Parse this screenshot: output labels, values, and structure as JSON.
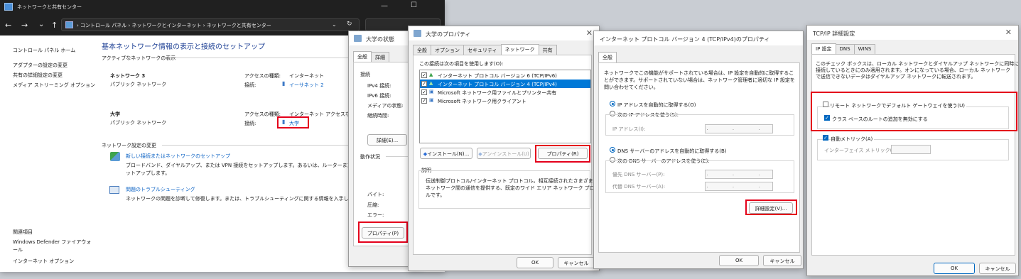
{
  "network_center": {
    "title": "ネットワークと共有センター",
    "breadcrumb": [
      "コントロール パネル",
      "ネットワークとインターネット",
      "ネットワークと共有センター"
    ],
    "sidebar_links": [
      "コントロール パネル ホーム",
      "アダプターの設定の変更",
      "共有の詳細設定の変更",
      "メディア ストリーミング オプション"
    ],
    "related_title": "関連項目",
    "related_links": [
      "Windows Defender ファイアウォール",
      "インターネット オプション"
    ],
    "heading": "基本ネットワーク情報の表示と接続のセットアップ",
    "active_networks_label": "アクティブなネットワークの表示",
    "access_type_label": "アクセスの種類:",
    "connection_label": "接続:",
    "networks": [
      {
        "name": "ネットワーク 3",
        "type": "パブリック ネットワーク",
        "access": "インターネット",
        "connection": "イーサネット 2"
      },
      {
        "name": "大学",
        "type": "パブリック ネットワーク",
        "access": "インターネット アクセスなし",
        "connection": "大学"
      }
    ],
    "change_settings_label": "ネットワーク設定の変更",
    "tasks": [
      {
        "title": "新しい接続またはネットワークのセットアップ",
        "desc1": "ブロードバンド、ダイヤルアップ、または VPN 接続をセットアップします。あるいは、ルーターまたはアクセス ポイ",
        "desc2": "ットアップします。"
      },
      {
        "title": "問題のトラブルシューティング",
        "desc1": "ネットワークの問題を診断して修復します。または、トラブルシューティングに関する情報を入手します。",
        "desc2": ""
      }
    ]
  },
  "status_dialog": {
    "title": "大学の状態",
    "tabs": [
      "全般",
      "詳細"
    ],
    "connection_label": "接続",
    "fields": [
      "IPv4 接続:",
      "IPv6 接続:",
      "メディアの状態:",
      "継続時間:"
    ],
    "details_button": "詳細(E)...",
    "activity_label": "動作状況",
    "stats": [
      "バイト:",
      "圧縮:",
      "エラー:"
    ],
    "properties_button": "プロパティ(P)"
  },
  "properties_dialog": {
    "title": "大学のプロパティ",
    "tabs": [
      "全般",
      "オプション",
      "セキュリティ",
      "ネットワーク",
      "共有"
    ],
    "items_label": "この接続は次の項目を使用します(O):",
    "items": [
      {
        "label": "インターネット プロトコル バージョン 6 (TCP/IPv6)",
        "checked": true,
        "selected": false
      },
      {
        "label": "インターネット プロトコル バージョン 4 (TCP/IPv4)",
        "checked": true,
        "selected": true
      },
      {
        "label": "Microsoft ネットワーク用ファイルとプリンター共有",
        "checked": true,
        "selected": false
      },
      {
        "label": "Microsoft ネットワーク用クライアント",
        "checked": true,
        "selected": false
      }
    ],
    "install_button": "インストール(N)...",
    "uninstall_button": "アンインストール(U)",
    "properties_button": "プロパティ(R)",
    "description_label": "説明",
    "description": [
      "伝送制御プロトコル/インターネット プロトコル。相互接続されたさまざまな",
      "ネットワーク間の通信を提供する、既定のワイド エリア ネットワーク プロトコ",
      "ルです。"
    ],
    "ok_button": "OK",
    "cancel_button": "キャンセル"
  },
  "ipv4_dialog": {
    "title": "インターネット プロトコル バージョン 4 (TCP/IPv4)のプロパティ",
    "tab": "全般",
    "intro": [
      "ネットワークでこの機能がサポートされている場合は、IP 設定を自動的に取得するこ",
      "とができます。サポートされていない場合は、ネットワーク管理者に適切な IP 設定を",
      "問い合わせてください。"
    ],
    "auto_ip": "IP アドレスを自動的に取得する(O)",
    "manual_ip": "次の IP アドレスを使う(S):",
    "ip_address_label": "IP アドレス(I):",
    "ip_placeholder": ". . .",
    "auto_dns": "DNS サーバーのアドレスを自動的に取得する(B)",
    "manual_dns": "次の DNS サーバーのアドレスを使う(E):",
    "preferred_dns": "優先 DNS サーバー(P):",
    "alternate_dns": "代替 DNS サーバー(A):",
    "advanced_button": "詳細設定(V)...",
    "ok_button": "OK",
    "cancel_button": "キャンセル"
  },
  "advanced_dialog": {
    "title": "TCP/IP 詳細設定",
    "tabs": [
      "IP 設定",
      "DNS",
      "WINS"
    ],
    "intro": [
      "このチェック ボックスは、ローカル ネットワークとダイヤルアップ ネットワークに同時に",
      "接続しているときにのみ適用されます。オンになっている場合、ローカル ネットワーク",
      "で送信できないデータはダイヤルアップ ネットワークに転送されます。"
    ],
    "remote_gateway": "リモート ネットワークでデフォルト ゲートウェイを使う(U)",
    "disable_class_route": "クラス ベースのルートの追加を無効にする",
    "auto_metric": "自動メトリック(A)",
    "interface_metric": "インターフェイス メトリック(N):",
    "ok_button": "OK",
    "cancel_button": "キャンセル"
  },
  "colors": {
    "highlight": "#0078d7",
    "red_box": "#e4001b",
    "link": "#0b62c4",
    "accent": "#0067c0"
  }
}
